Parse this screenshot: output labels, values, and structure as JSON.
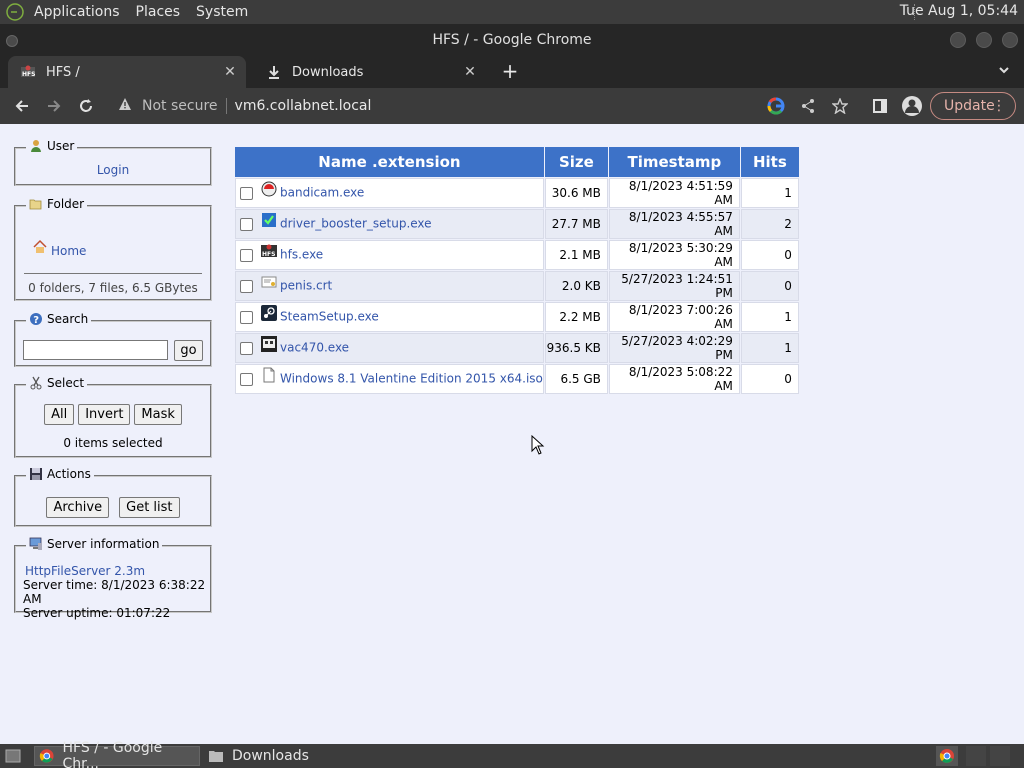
{
  "top_panel": {
    "menus": [
      "Applications",
      "Places",
      "System"
    ],
    "clock": "Tue Aug 1, 05:44"
  },
  "window": {
    "title": "HFS / - Google Chrome"
  },
  "tabs": [
    {
      "title": "HFS /",
      "icon": "hfs-favicon"
    },
    {
      "title": "Downloads",
      "icon": "download-icon"
    }
  ],
  "toolbar": {
    "security": "Not secure",
    "url": "vm6.collabnet.local",
    "update_label": "Update"
  },
  "sidebar": {
    "user": {
      "legend": "User",
      "login": "Login"
    },
    "folder": {
      "legend": "Folder",
      "home": "Home",
      "stats": "0 folders, 7 files, 6.5 GBytes"
    },
    "search": {
      "legend": "Search",
      "value": "",
      "go": "go"
    },
    "select": {
      "legend": "Select",
      "all": "All",
      "invert": "Invert",
      "mask": "Mask",
      "status": "0 items selected"
    },
    "actions": {
      "legend": "Actions",
      "archive": "Archive",
      "getlist": "Get list"
    },
    "server": {
      "legend": "Server information",
      "version": "HttpFileServer 2.3m",
      "time": "Server time: 8/1/2023 6:38:22 AM",
      "uptime": "Server uptime: 01:07:22"
    }
  },
  "table": {
    "headers": {
      "name": "Name .extension",
      "size": "Size",
      "timestamp": "Timestamp",
      "hits": "Hits"
    },
    "rows": [
      {
        "name": "bandicam.exe",
        "size": "30.6 MB",
        "timestamp": "8/1/2023 4:51:59 AM",
        "hits": "1",
        "icon": "bandicam-icon"
      },
      {
        "name": "driver_booster_setup.exe",
        "size": "27.7 MB",
        "timestamp": "8/1/2023 4:55:57 AM",
        "hits": "2",
        "icon": "installer-icon"
      },
      {
        "name": "hfs.exe",
        "size": "2.1 MB",
        "timestamp": "8/1/2023 5:30:29 AM",
        "hits": "0",
        "icon": "hfs-icon"
      },
      {
        "name": "penis.crt",
        "size": "2.0 KB",
        "timestamp": "5/27/2023 1:24:51 PM",
        "hits": "0",
        "icon": "certificate-icon"
      },
      {
        "name": "SteamSetup.exe",
        "size": "2.2 MB",
        "timestamp": "8/1/2023 7:00:26 AM",
        "hits": "1",
        "icon": "steam-icon"
      },
      {
        "name": "vac470.exe",
        "size": "936.5 KB",
        "timestamp": "5/27/2023 4:02:29 PM",
        "hits": "1",
        "icon": "app-icon"
      },
      {
        "name": "Windows 8.1 Valentine Edition 2015 x64.iso",
        "size": "6.5 GB",
        "timestamp": "8/1/2023 5:08:22 AM",
        "hits": "0",
        "icon": "file-icon"
      }
    ]
  },
  "taskbar": {
    "items": [
      "HFS / - Google Chr...",
      "Downloads"
    ]
  }
}
